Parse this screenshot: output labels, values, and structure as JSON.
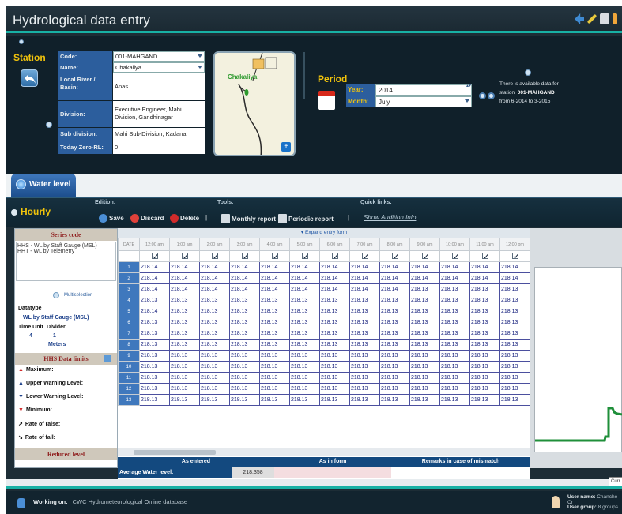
{
  "app": {
    "title": "Hydrological data entry"
  },
  "station": {
    "title": "Station",
    "fields": [
      {
        "label": "Code:",
        "value": "001-MAHGAND"
      },
      {
        "label": "Name:",
        "value": "Chakaliya"
      },
      {
        "label": "Local River / Basin:",
        "value": "Anas"
      },
      {
        "label": "Division:",
        "value": "Executive Engineer, Mahi Division, Gandhinagar"
      },
      {
        "label": "Sub division:",
        "value": "Mahi Sub-Division, Kadana"
      },
      {
        "label": "Today Zero-RL:",
        "value": "0"
      }
    ],
    "map_label": "Chakaliya"
  },
  "period": {
    "title": "Period",
    "year_label": "Year:",
    "year": "2014",
    "month_label": "Month:",
    "month": "July",
    "availability": [
      "There is available data for",
      "station",
      "001-MAHGAND",
      "from 6-2014 to 3-2015"
    ]
  },
  "tab": {
    "water_level": "Water level"
  },
  "toolbar": {
    "hourly": "Hourly",
    "edition_label": "Edition:",
    "tools_label": "Tools:",
    "quick_label": "Quick links:",
    "save": "Save",
    "discard": "Discard",
    "delete": "Delete",
    "monthly_report": "Monthly report",
    "periodic_report": "Periodic report",
    "quick_link": "Show Audition Info",
    "pipe": "|"
  },
  "left": {
    "series_header": "Series code",
    "series": [
      "HHS - WL by Staff Gauge (MSL)",
      "HHT - WL by Telemetry"
    ],
    "multiselection": "Multiselection",
    "datatype_label": "Datatype",
    "datatype_value": "WL by Staff Gauge (MSL)",
    "time_unit_label": "Time Unit",
    "divider_label": "Divider",
    "time_unit": "4",
    "divider": "1",
    "unit": "Meters",
    "limits_header": "HHS Data limits",
    "limits": [
      "Maximum:",
      "Upper Warning Level:",
      "Lower Warning Level:",
      "Minimum:",
      "Rate of raise:",
      "Rate of fall:"
    ],
    "reduced_header": "Reduced level"
  },
  "grid": {
    "expand": "Expand entry form",
    "date_header": "DATE",
    "hours": [
      "12:00 am",
      "1:00 am",
      "2:00 am",
      "3:00 am",
      "4:00 am",
      "5:00 am",
      "6:00 am",
      "7:00 am",
      "8:00 am",
      "9:00 am",
      "10:00 am",
      "11:00 am",
      "12:00 pm"
    ],
    "rows": [
      {
        "day": "1",
        "vals": [
          "218.14",
          "218.14",
          "218.14",
          "218.14",
          "218.14",
          "218.14",
          "218.14",
          "218.14",
          "218.14",
          "218.14",
          "218.14",
          "218.14",
          "218.14"
        ]
      },
      {
        "day": "2",
        "vals": [
          "218.14",
          "218.14",
          "218.14",
          "218.14",
          "218.14",
          "218.14",
          "218.14",
          "218.14",
          "218.14",
          "218.14",
          "218.14",
          "218.14",
          "218.14"
        ]
      },
      {
        "day": "3",
        "vals": [
          "218.14",
          "218.14",
          "218.14",
          "218.14",
          "218.14",
          "218.14",
          "218.14",
          "218.14",
          "218.14",
          "218.13",
          "218.13",
          "218.13",
          "218.13"
        ]
      },
      {
        "day": "4",
        "vals": [
          "218.13",
          "218.13",
          "218.13",
          "218.13",
          "218.13",
          "218.13",
          "218.13",
          "218.13",
          "218.13",
          "218.13",
          "218.13",
          "218.13",
          "218.13"
        ]
      },
      {
        "day": "5",
        "vals": [
          "218.14",
          "218.13",
          "218.13",
          "218.13",
          "218.13",
          "218.13",
          "218.13",
          "218.13",
          "218.13",
          "218.13",
          "218.13",
          "218.13",
          "218.13"
        ]
      },
      {
        "day": "6",
        "vals": [
          "218.13",
          "218.13",
          "218.13",
          "218.13",
          "218.13",
          "218.13",
          "218.13",
          "218.13",
          "218.13",
          "218.13",
          "218.13",
          "218.13",
          "218.13"
        ]
      },
      {
        "day": "7",
        "vals": [
          "218.13",
          "218.13",
          "218.13",
          "218.13",
          "218.13",
          "218.13",
          "218.13",
          "218.13",
          "218.13",
          "218.13",
          "218.13",
          "218.13",
          "218.13"
        ]
      },
      {
        "day": "8",
        "vals": [
          "218.13",
          "218.13",
          "218.13",
          "218.13",
          "218.13",
          "218.13",
          "218.13",
          "218.13",
          "218.13",
          "218.13",
          "218.13",
          "218.13",
          "218.13"
        ]
      },
      {
        "day": "9",
        "vals": [
          "218.13",
          "218.13",
          "218.13",
          "218.13",
          "218.13",
          "218.13",
          "218.13",
          "218.13",
          "218.13",
          "218.13",
          "218.13",
          "218.13",
          "218.13"
        ]
      },
      {
        "day": "10",
        "vals": [
          "218.13",
          "218.13",
          "218.13",
          "218.13",
          "218.13",
          "218.13",
          "218.13",
          "218.13",
          "218.13",
          "218.13",
          "218.13",
          "218.13",
          "218.13"
        ]
      },
      {
        "day": "11",
        "vals": [
          "218.13",
          "218.13",
          "218.13",
          "218.13",
          "218.13",
          "218.13",
          "218.13",
          "218.13",
          "218.13",
          "218.13",
          "218.13",
          "218.13",
          "218.13"
        ]
      },
      {
        "day": "12",
        "vals": [
          "218.13",
          "218.13",
          "218.13",
          "218.13",
          "218.13",
          "218.13",
          "218.13",
          "218.13",
          "218.13",
          "218.13",
          "218.13",
          "218.13",
          "218.13"
        ]
      },
      {
        "day": "13",
        "vals": [
          "218.13",
          "218.13",
          "218.13",
          "218.13",
          "218.13",
          "218.13",
          "218.13",
          "218.13",
          "218.13",
          "218.13",
          "218.13",
          "218.13",
          "218.13"
        ]
      }
    ]
  },
  "summary": {
    "as_entered": "As entered",
    "as_in_form": "As in form",
    "remarks": "Remarks in case of mismatch",
    "avg_label": "Average Water level:",
    "avg_value": "218.358"
  },
  "status": {
    "working_on": "Working on:",
    "database": "CWC Hydrometeorological Online database",
    "user_name_label": "User name:",
    "user_name": "Chanche Cr",
    "user_group_label": "User group:",
    "user_group": "8 groups",
    "tooltip": "Curr"
  },
  "colors": {
    "accent": "#f1c30c",
    "teal": "#18b1a5",
    "blue": "#2c5e9d",
    "chart_line": "#1f8f3a"
  }
}
